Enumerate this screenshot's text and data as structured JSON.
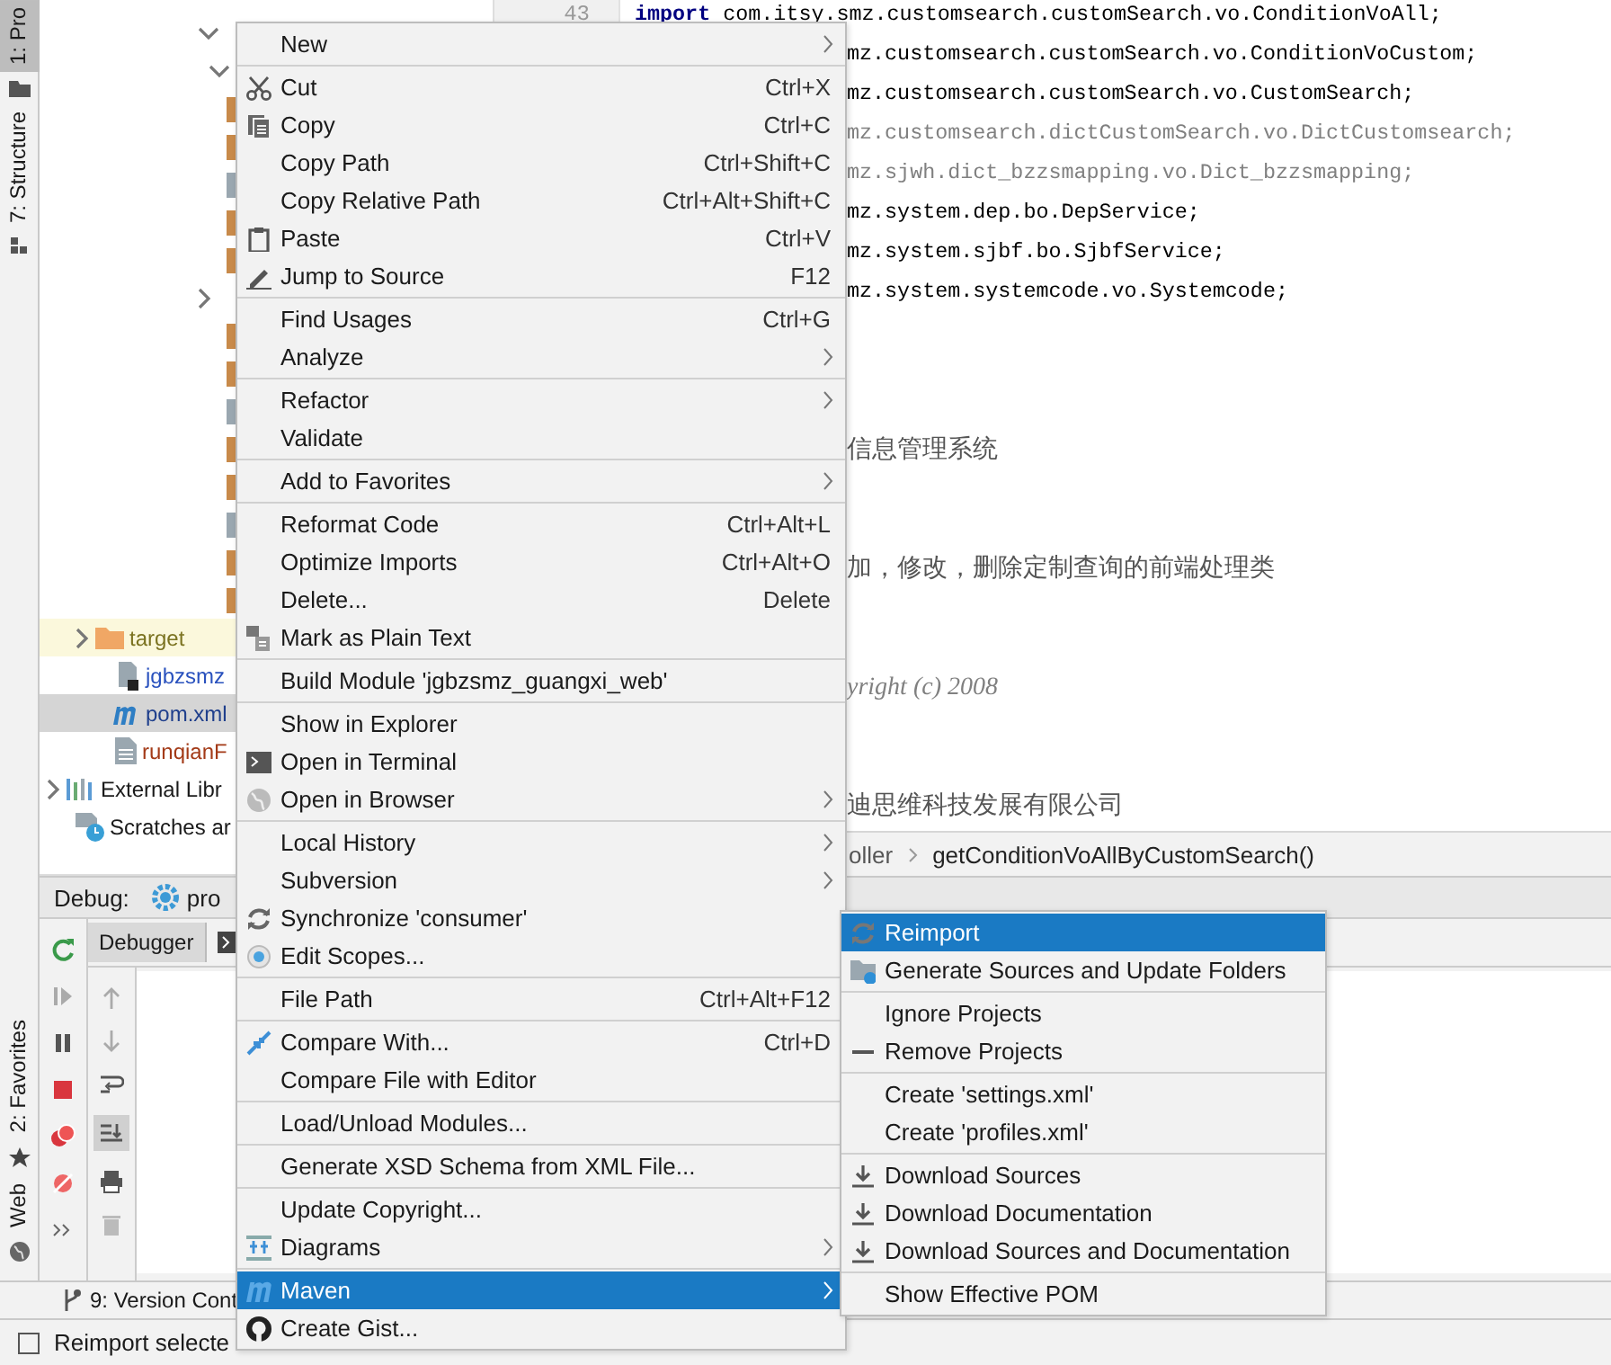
{
  "tool_strip": {
    "tabs": [
      {
        "label": "1: Pro",
        "selected": true
      },
      {
        "label": "7: Structure",
        "selected": false
      }
    ],
    "bottom_tabs": [
      {
        "label": "2: Favorites",
        "selected": false
      },
      {
        "label": "Web",
        "selected": false
      }
    ]
  },
  "project_tree": {
    "items": [
      {
        "label": "target",
        "expanded": false,
        "kind": "folder",
        "highlighted": true,
        "selected": false
      },
      {
        "label": "jgbzsmz",
        "kind": "module-file",
        "highlighted": false,
        "selected": false
      },
      {
        "label": "pom.xml",
        "kind": "maven-file",
        "highlighted": false,
        "selected": true
      },
      {
        "label": "runqianF",
        "kind": "text-file",
        "highlighted": false,
        "selected": false
      },
      {
        "label": "External Libr",
        "expanded": false,
        "kind": "libraries",
        "highlighted": false,
        "selected": false
      },
      {
        "label": "Scratches ar",
        "kind": "scratches",
        "highlighted": false,
        "selected": false
      }
    ]
  },
  "editor": {
    "line_number": "43",
    "lines": [
      {
        "kind": "import",
        "covered": false,
        "text": "**import** com.itsy.smz.customsearch.customSearch.vo.ConditionVoAll;"
      },
      {
        "kind": "import",
        "covered": true,
        "text": "mz.customsearch.customSearch.vo.ConditionVoCustom;"
      },
      {
        "kind": "import",
        "covered": true,
        "text": "mz.customsearch.customSearch.vo.CustomSearch;"
      },
      {
        "kind": "unused",
        "covered": true,
        "text": "mz.customsearch.dictCustomSearch.vo.DictCustomsearch;"
      },
      {
        "kind": "unused",
        "covered": true,
        "text": "mz.sjwh.dict_bzzsmapping.vo.Dict_bzzsmapping;"
      },
      {
        "kind": "import",
        "covered": true,
        "text": "mz.system.dep.bo.DepService;"
      },
      {
        "kind": "import",
        "covered": true,
        "text": "mz.system.sjbf.bo.SjbfService;"
      },
      {
        "kind": "import",
        "covered": true,
        "text": "mz.system.systemcode.vo.Systemcode;"
      },
      {
        "kind": "blank"
      },
      {
        "kind": "blank"
      },
      {
        "kind": "blank"
      },
      {
        "kind": "comment",
        "covered": true,
        "text": "信息管理系统"
      },
      {
        "kind": "blank"
      },
      {
        "kind": "blank"
      },
      {
        "kind": "comment",
        "covered": true,
        "text": "加，修改，删除定制查询的前端处理类"
      },
      {
        "kind": "blank"
      },
      {
        "kind": "blank"
      },
      {
        "kind": "doc",
        "covered": true,
        "text": "yright (c) 2008"
      },
      {
        "kind": "blank"
      },
      {
        "kind": "blank"
      },
      {
        "kind": "comment",
        "covered": true,
        "text": "迪思维科技发展有限公司"
      }
    ],
    "breadcrumbs": [
      "oller",
      "getConditionVoAllByCustomSearch()"
    ]
  },
  "debug": {
    "title": "Debug:",
    "config": "pro",
    "tabs": [
      {
        "label": "Debugger",
        "selected": true
      }
    ]
  },
  "version_bar": {
    "label": "9: Version Cont"
  },
  "status_bar": {
    "text": "Reimport selecte"
  },
  "context_menu": {
    "groups": [
      [
        {
          "label": "New",
          "submenu": true,
          "selected": false
        }
      ],
      [
        {
          "label": "Cut",
          "shortcut": "Ctrl+X",
          "selected": false
        },
        {
          "label": "Copy",
          "shortcut": "Ctrl+C",
          "selected": false
        },
        {
          "label": "Copy Path",
          "shortcut": "Ctrl+Shift+C",
          "selected": false
        },
        {
          "label": "Copy Relative Path",
          "shortcut": "Ctrl+Alt+Shift+C",
          "selected": false
        },
        {
          "label": "Paste",
          "shortcut": "Ctrl+V",
          "selected": false
        },
        {
          "label": "Jump to Source",
          "shortcut": "F12",
          "selected": false
        }
      ],
      [
        {
          "label": "Find Usages",
          "shortcut": "Ctrl+G",
          "selected": false
        },
        {
          "label": "Analyze",
          "submenu": true,
          "selected": false
        }
      ],
      [
        {
          "label": "Refactor",
          "submenu": true,
          "selected": false
        },
        {
          "label": "Validate",
          "selected": false
        }
      ],
      [
        {
          "label": "Add to Favorites",
          "submenu": true,
          "selected": false
        }
      ],
      [
        {
          "label": "Reformat Code",
          "shortcut": "Ctrl+Alt+L",
          "selected": false
        },
        {
          "label": "Optimize Imports",
          "shortcut": "Ctrl+Alt+O",
          "selected": false
        },
        {
          "label": "Delete...",
          "shortcut": "Delete",
          "selected": false
        },
        {
          "label": "Mark as Plain Text",
          "selected": false
        }
      ],
      [
        {
          "label": "Build Module 'jgbzsmz_guangxi_web'",
          "selected": false
        }
      ],
      [
        {
          "label": "Show in Explorer",
          "selected": false
        },
        {
          "label": "Open in Terminal",
          "selected": false
        },
        {
          "label": "Open in Browser",
          "submenu": true,
          "selected": false
        }
      ],
      [
        {
          "label": "Local History",
          "submenu": true,
          "selected": false
        },
        {
          "label": "Subversion",
          "submenu": true,
          "selected": false
        },
        {
          "label": "Synchronize 'consumer'",
          "selected": false
        },
        {
          "label": "Edit Scopes...",
          "selected": false
        }
      ],
      [
        {
          "label": "File Path",
          "shortcut": "Ctrl+Alt+F12",
          "selected": false
        }
      ],
      [
        {
          "label": "Compare With...",
          "shortcut": "Ctrl+D",
          "selected": false
        },
        {
          "label": "Compare File with Editor",
          "selected": false
        }
      ],
      [
        {
          "label": "Load/Unload Modules...",
          "selected": false
        }
      ],
      [
        {
          "label": "Generate XSD Schema from XML File...",
          "selected": false
        }
      ],
      [
        {
          "label": "Update Copyright...",
          "selected": false
        },
        {
          "label": "Diagrams",
          "submenu": true,
          "selected": false
        }
      ],
      [
        {
          "label": "Maven",
          "submenu": true,
          "selected": true
        },
        {
          "label": "Create Gist...",
          "selected": false
        }
      ]
    ]
  },
  "maven_submenu": {
    "groups": [
      [
        {
          "label": "Reimport",
          "selected": true
        },
        {
          "label": "Generate Sources and Update Folders",
          "selected": false
        }
      ],
      [
        {
          "label": "Ignore Projects",
          "selected": false
        },
        {
          "label": "Remove Projects",
          "selected": false
        }
      ],
      [
        {
          "label": "Create 'settings.xml'",
          "selected": false
        },
        {
          "label": "Create 'profiles.xml'",
          "selected": false
        }
      ],
      [
        {
          "label": "Download Sources",
          "selected": false
        },
        {
          "label": "Download Documentation",
          "selected": false
        },
        {
          "label": "Download Sources and Documentation",
          "selected": false
        }
      ],
      [
        {
          "label": "Show Effective POM",
          "selected": false
        }
      ]
    ]
  }
}
